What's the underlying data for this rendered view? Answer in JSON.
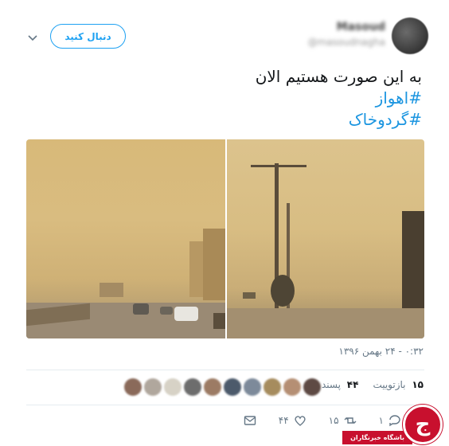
{
  "header": {
    "follow_label": "دنبال کنید",
    "display_name": "Masoud",
    "handle": "@masoudnagha"
  },
  "tweet": {
    "text": "به این صورت هستیم الان",
    "hashtags": [
      "#اهواز",
      "#گردوخاک"
    ],
    "timestamp": "۰:۳۲ - ۲۴ بهمن ۱۳۹۶"
  },
  "stats": {
    "retweets_count": "۱۵",
    "retweets_label": "بازتوییت",
    "likes_count": "۴۴",
    "likes_label": "پسند"
  },
  "actions": {
    "reply_count": "۱",
    "retweet_count": "۱۵",
    "like_count": "۴۴"
  },
  "colors": {
    "accent": "#1da1f2",
    "hashtag": "#1b95e0",
    "logo": "#c8102e"
  },
  "icons": [
    "chevron-down-icon",
    "reply-icon",
    "retweet-icon",
    "heart-icon",
    "message-icon"
  ],
  "watermark": {
    "logo_text": "باشگاه خبرنگاران"
  }
}
